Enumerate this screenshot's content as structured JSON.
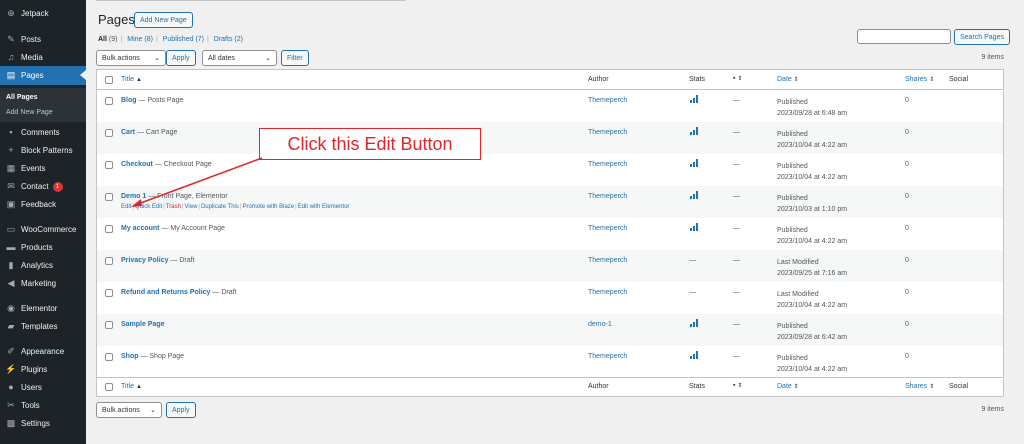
{
  "sidebar": {
    "items": [
      {
        "label": "Jetpack",
        "icon": "jetpack-icon"
      },
      {
        "label": "Posts",
        "icon": "pin-icon"
      },
      {
        "label": "Media",
        "icon": "media-icon"
      },
      {
        "label": "Pages",
        "icon": "pages-icon",
        "active": true
      },
      {
        "label": "Comments",
        "icon": "comment-icon"
      },
      {
        "label": "Block Patterns",
        "icon": "plus-icon"
      },
      {
        "label": "Events",
        "icon": "calendar-icon"
      },
      {
        "label": "Contact",
        "icon": "mail-icon",
        "badge": "1"
      },
      {
        "label": "Feedback",
        "icon": "feedback-icon"
      },
      {
        "label": "WooCommerce",
        "icon": "woo-icon"
      },
      {
        "label": "Products",
        "icon": "archive-icon"
      },
      {
        "label": "Analytics",
        "icon": "bar-chart-icon"
      },
      {
        "label": "Marketing",
        "icon": "megaphone-icon"
      },
      {
        "label": "Elementor",
        "icon": "elementor-icon"
      },
      {
        "label": "Templates",
        "icon": "folder-icon"
      },
      {
        "label": "Appearance",
        "icon": "brush-icon"
      },
      {
        "label": "Plugins",
        "icon": "plugin-icon"
      },
      {
        "label": "Users",
        "icon": "user-icon"
      },
      {
        "label": "Tools",
        "icon": "wrench-icon"
      },
      {
        "label": "Settings",
        "icon": "settings-icon"
      }
    ],
    "submenu": {
      "all_pages": "All Pages",
      "add_new": "Add New Page"
    }
  },
  "header": {
    "title": "Pages",
    "add_new": "Add New Page",
    "search_button": "Search Pages",
    "search_value": ""
  },
  "views": {
    "all": "All",
    "all_count": "(9)",
    "mine": "Mine",
    "mine_count": "(8)",
    "published": "Published",
    "published_count": "(7)",
    "drafts": "Drafts",
    "drafts_count": "(2)"
  },
  "filters": {
    "bulk_actions": "Bulk actions",
    "apply": "Apply",
    "dates": "All dates",
    "filter": "Filter",
    "items_count": "9 items"
  },
  "columns": {
    "title": "Title",
    "author": "Author",
    "stats": "Stats",
    "date": "Date",
    "shares": "Shares",
    "social": "Social"
  },
  "rows": [
    {
      "title": "Blog",
      "state": " — Posts Page",
      "author": "Themeperch",
      "stats": "—",
      "comments": "—",
      "status": "Published",
      "date": "2023/09/28 at 6:48 am",
      "shares": "0",
      "has_stats": true
    },
    {
      "title": "Cart",
      "state": " — Cart Page",
      "author": "Themeperch",
      "stats": "—",
      "comments": "—",
      "status": "Published",
      "date": "2023/10/04 at 4:22 am",
      "shares": "0",
      "has_stats": true
    },
    {
      "title": "Checkout",
      "state": " — Checkout Page",
      "author": "Themeperch",
      "stats": "—",
      "comments": "—",
      "status": "Published",
      "date": "2023/10/04 at 4:22 am",
      "shares": "0",
      "has_stats": true
    },
    {
      "title": "Demo 1",
      "state": " — Front Page, Elementor",
      "author": "Themeperch",
      "stats": "—",
      "comments": "—",
      "status": "Published",
      "date": "2023/10/03 at 1:10 pm",
      "shares": "0",
      "has_stats": true
    },
    {
      "title": "My account",
      "state": " — My Account Page",
      "author": "Themeperch",
      "stats": "—",
      "comments": "—",
      "status": "Published",
      "date": "2023/10/04 at 4:22 am",
      "shares": "0",
      "has_stats": true
    },
    {
      "title": "Privacy Policy",
      "state": " — Draft",
      "author": "Themeperch",
      "stats": "—",
      "comments": "—",
      "status": "Last Modified",
      "date": "2023/09/25 at 7:16 am",
      "shares": "0",
      "has_stats": false
    },
    {
      "title": "Refund and Returns Policy",
      "state": " — Draft",
      "author": "Themeperch",
      "stats": "—",
      "comments": "—",
      "status": "Last Modified",
      "date": "2023/10/04 at 4:22 am",
      "shares": "0",
      "has_stats": false
    },
    {
      "title": "Sample Page",
      "state": "",
      "author": "demo-1",
      "stats": "—",
      "comments": "—",
      "status": "Published",
      "date": "2023/09/28 at 6:42 am",
      "shares": "0",
      "has_stats": true
    },
    {
      "title": "Shop",
      "state": " — Shop Page",
      "author": "Themeperch",
      "stats": "—",
      "comments": "—",
      "status": "Published",
      "date": "2023/10/04 at 4:22 am",
      "shares": "0",
      "has_stats": true
    }
  ],
  "row_actions": {
    "edit": "Edit",
    "quick_edit": "Quick Edit",
    "trash": "Trash",
    "view": "View",
    "duplicate": "Duplicate This",
    "promote": "Promote with Blaze",
    "elementor": "Edit with Elementor"
  },
  "annotation": {
    "text": "Click this Edit Button",
    "color": "#e0262b"
  },
  "colors": {
    "sidebar": "#1d2327",
    "accent": "#2271b1",
    "background": "#f0f0f1"
  }
}
